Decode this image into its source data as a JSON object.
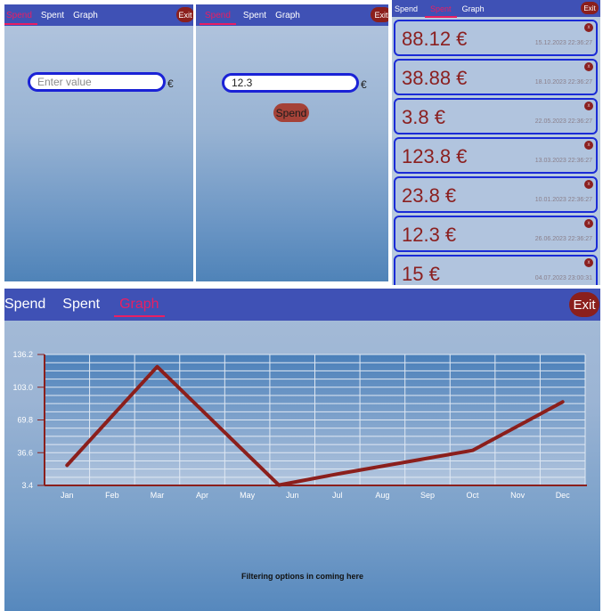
{
  "screen1": {
    "tabs": [
      "Spend",
      "Spent",
      "Graph"
    ],
    "active_tab": 0,
    "exit_label": "Exit",
    "input_placeholder": "Enter value",
    "currency": "€"
  },
  "screen2": {
    "tabs": [
      "Spend",
      "Spent",
      "Graph"
    ],
    "active_tab": 0,
    "exit_label": "Exit",
    "input_value": "12.3",
    "currency": "€",
    "spend_button": "Spend"
  },
  "screen3": {
    "tabs": [
      "Spend",
      "Spent",
      "Graph"
    ],
    "active_tab": 1,
    "exit_label": "Exit",
    "delete_icon_glyph": "x",
    "items": [
      {
        "amount": "88.12 €",
        "date": "15.12.2023 22:36:27"
      },
      {
        "amount": "38.88 €",
        "date": "18.10.2023 22:36:27"
      },
      {
        "amount": "3.8 €",
        "date": "22.05.2023 22:36:27"
      },
      {
        "amount": "123.8 €",
        "date": "13.03.2023 22:36:27"
      },
      {
        "amount": "23.8 €",
        "date": "10.01.2023 22:36:27"
      },
      {
        "amount": "12.3 €",
        "date": "26.06.2023 22:36:27"
      },
      {
        "amount": "15 €",
        "date": "04.07.2023 23:00:31"
      }
    ]
  },
  "screen4": {
    "tabs": [
      "Spend",
      "Spent",
      "Graph"
    ],
    "active_tab": 2,
    "exit_label": "Exit",
    "filter_text": "Filtering options in coming here"
  },
  "chart_data": {
    "type": "line",
    "categories": [
      "Jan",
      "Feb",
      "Mar",
      "Apr",
      "May",
      "Jun",
      "Jul",
      "Aug",
      "Sep",
      "Oct",
      "Nov",
      "Dec"
    ],
    "x": [
      1,
      3,
      5.7,
      7,
      10,
      12
    ],
    "series": [
      {
        "values": [
          23.8,
          123.8,
          3.8,
          15,
          38.88,
          88.12
        ]
      }
    ],
    "y_ticks": [
      "3.4",
      "36.6",
      "69.8",
      "103.0",
      "136.2"
    ],
    "ylim": [
      3.4,
      136.2
    ],
    "grid": true,
    "line_color": "#8b1f1c",
    "title": "",
    "xlabel": "",
    "ylabel": ""
  }
}
